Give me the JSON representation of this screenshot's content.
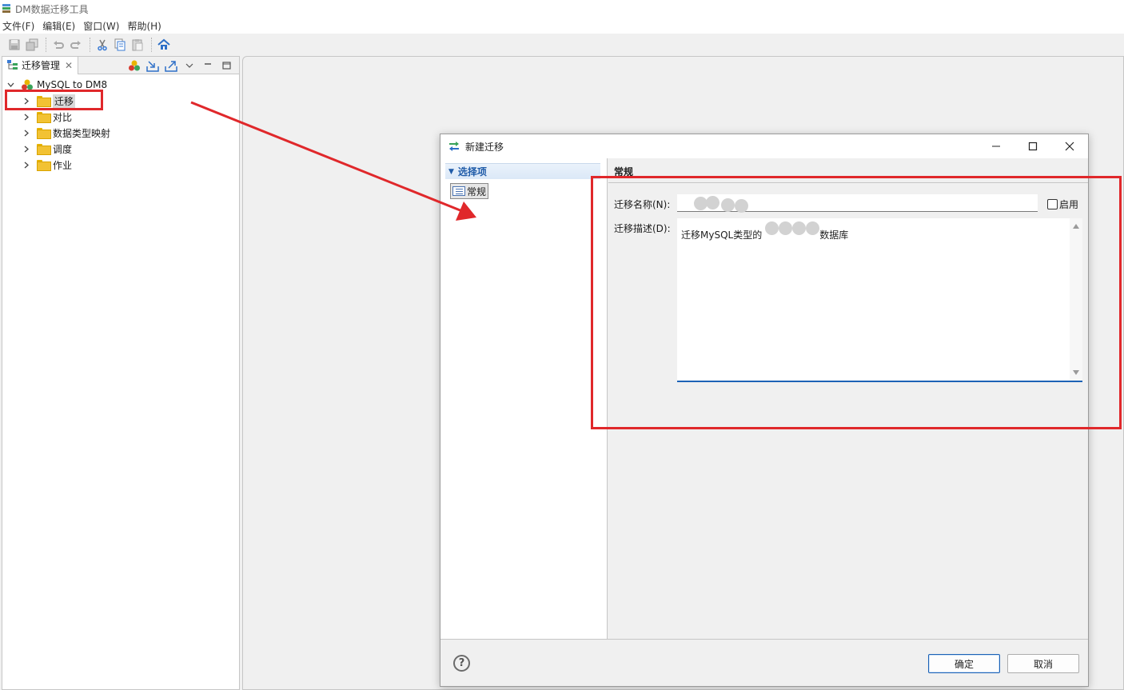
{
  "app": {
    "title": "DM数据迁移工具"
  },
  "menu": {
    "items": [
      "文件(F)",
      "编辑(E)",
      "窗口(W)",
      "帮助(H)"
    ]
  },
  "left_view": {
    "tab_label": "迁移管理",
    "tree": {
      "root": "MySQL to DM8",
      "children": [
        "迁移",
        "对比",
        "数据类型映射",
        "调度",
        "作业"
      ]
    }
  },
  "dialog": {
    "title": "新建迁移",
    "options_header": "选择项",
    "option_item": "常规",
    "section_title": "常规",
    "name_label": "迁移名称(N):",
    "name_value": "",
    "enable_label": "启用",
    "desc_label": "迁移描述(D):",
    "desc_prefix": "迁移MySQL类型的",
    "desc_suffix": "数据库",
    "ok_label": "确定",
    "cancel_label": "取消"
  },
  "colors": {
    "annotation_red": "#e0282b",
    "accent_blue": "#1d63b6",
    "folder_yellow": "#f2c233"
  }
}
